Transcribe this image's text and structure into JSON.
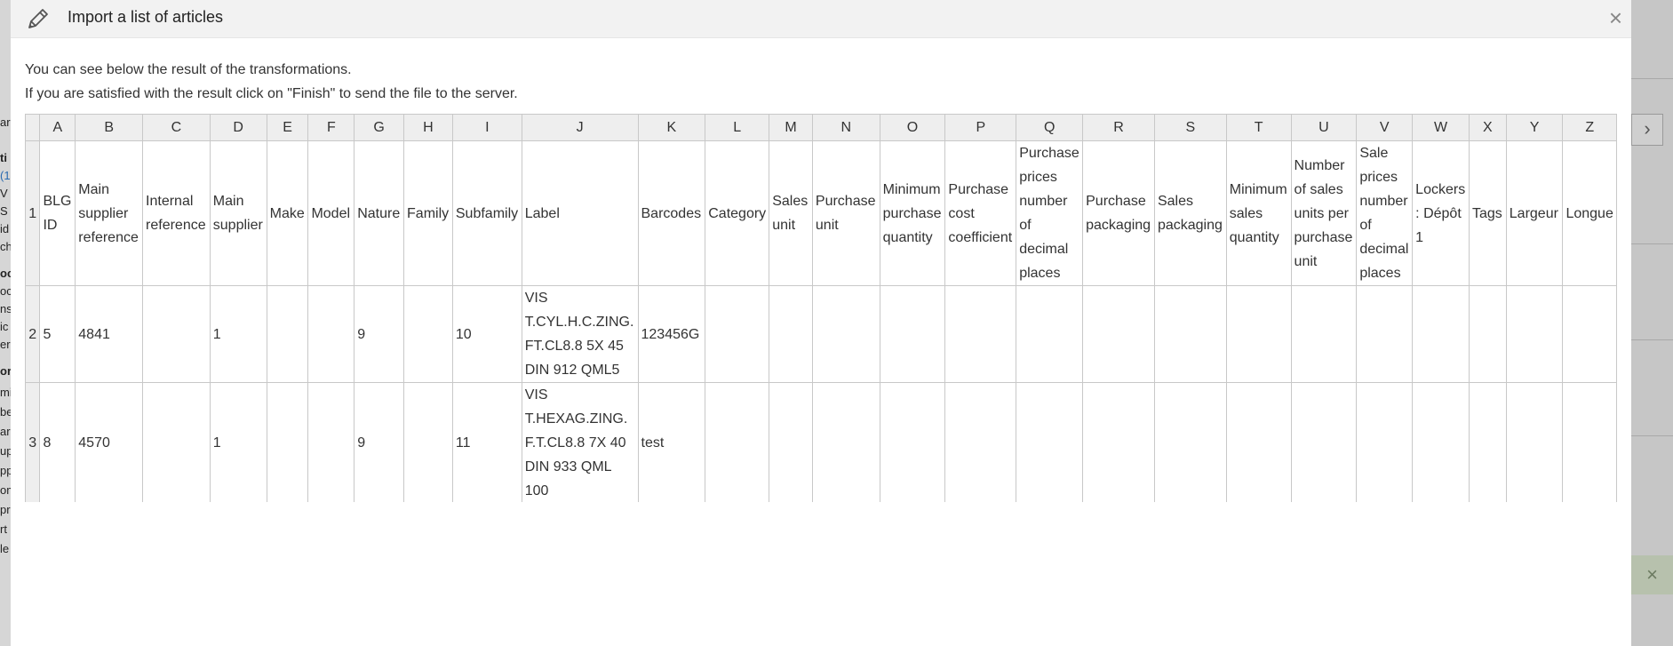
{
  "modal": {
    "title": "Import a list of articles",
    "close_label": "×",
    "intro_line1": "You can see below the result of the transformations.",
    "intro_line2": "If you are satisfied with the result click on \"Finish\" to send the file to the server."
  },
  "background": {
    "left_fragments": [
      "ar",
      "ti",
      "(1",
      "V",
      "S",
      "id",
      "ch",
      "oc",
      "oc",
      "ns",
      "ic",
      "er",
      "or",
      "mi",
      "be",
      "ar",
      "up",
      "pp",
      "om",
      "pr",
      "rt",
      "le"
    ],
    "arrow_label": "›",
    "toast_close": "×"
  },
  "table": {
    "column_letters": [
      "A",
      "B",
      "C",
      "D",
      "E",
      "F",
      "G",
      "H",
      "I",
      "J",
      "K",
      "L",
      "M",
      "N",
      "O",
      "P",
      "Q",
      "R",
      "S",
      "T",
      "U",
      "V",
      "W",
      "X",
      "Y",
      "Z"
    ],
    "rows": [
      {
        "num": "1",
        "cells": [
          "BLG ID",
          "Main supplier reference",
          "Internal reference",
          "Main supplier",
          "Make",
          "Model",
          "Nature",
          "Family",
          "Subfamily",
          "Label",
          "Barcodes",
          "Category",
          "Sales unit",
          "Purchase unit",
          "Minimum purchase quantity",
          "Purchase cost coefficient",
          "Purchase prices number of decimal places",
          "Purchase packaging",
          "Sales packaging",
          "Minimum sales quantity",
          "Number of sales units per purchase unit",
          "Sale prices number of decimal places",
          "Lockers : Dépôt 1",
          "Tags",
          "Largeur",
          "Longue"
        ]
      },
      {
        "num": "2",
        "cells": [
          "5",
          "4841",
          "",
          "1",
          "",
          "",
          "9",
          "",
          "10",
          "VIS T.CYL.H.C.ZING. FT.CL8.8 5X 45 DIN 912 QML5",
          "123456G",
          "",
          "",
          "",
          "",
          "",
          "",
          "",
          "",
          "",
          "",
          "",
          "",
          "",
          "",
          ""
        ]
      },
      {
        "num": "3",
        "cells": [
          "8",
          "4570",
          "",
          "1",
          "",
          "",
          "9",
          "",
          "11",
          "VIS T.HEXAG.ZING. F.T.CL8.8 7X 40 DIN 933 QML 100",
          "test",
          "",
          "",
          "",
          "",
          "",
          "",
          "",
          "",
          "",
          "",
          "",
          "",
          "",
          "",
          ""
        ]
      }
    ]
  }
}
